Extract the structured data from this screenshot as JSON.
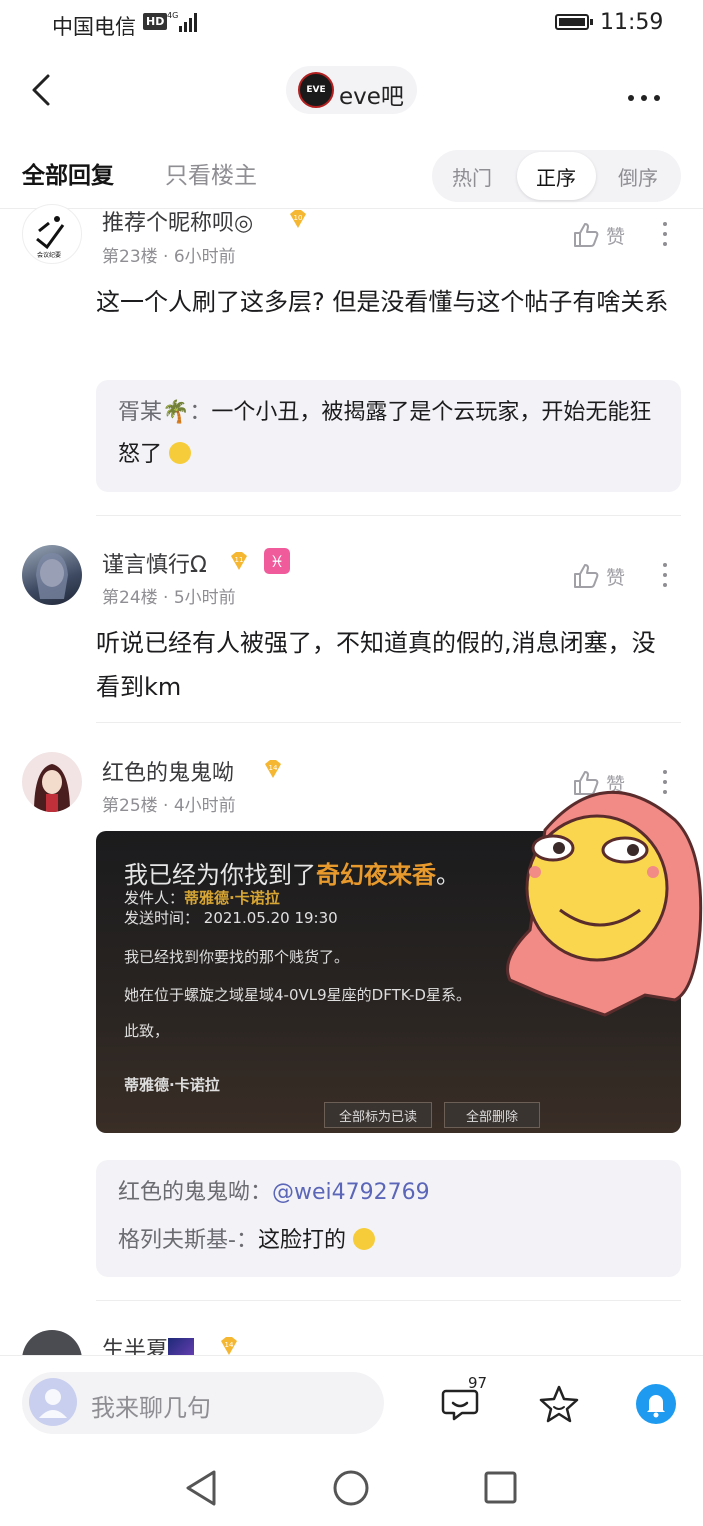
{
  "status": {
    "carrier": "中国电信",
    "hd": "HD",
    "network": "4G",
    "time": "11:59"
  },
  "nav": {
    "forum_name": "eve吧",
    "forum_logo_text": "EVE"
  },
  "tabs": {
    "all": "全部回复",
    "op_only": "只看楼主"
  },
  "sort": {
    "hot": "热门",
    "asc": "正序",
    "desc": "倒序",
    "selected": "正序"
  },
  "like_label": "赞",
  "posts": [
    {
      "username": "推荐个昵称呗◎",
      "level": "10",
      "floor": "第23楼",
      "time": "6小时前",
      "content": "这一个人刷了这多层? 但是没看懂与这个帖子有啥关系",
      "avatar_text": "会议纪要",
      "reply": {
        "name": "胥某🌴",
        "text": "一个小丑，被揭露了是个云玩家，开始无能狂怒了"
      }
    },
    {
      "username": "谨言慎行Ω",
      "level": "11",
      "extra_badge": "♓",
      "floor": "第24楼",
      "time": "5小时前",
      "content": "听说已经有人被强了，不知道真的假的,消息闭塞，没看到km"
    },
    {
      "username": "红色的鬼鬼呦",
      "level": "14",
      "floor": "第25楼",
      "time": "4小时前",
      "image": {
        "title_prefix": "我已经为你找到了",
        "title_highlight": "奇幻夜来香",
        "title_suffix": "。",
        "sender_label": "发件人：",
        "sender": "蒂雅德·卡诺拉",
        "sent_label": "发送时间：",
        "sent_time": "2021.05.20 19:30",
        "line1": "我已经找到你要找的那个贱货了。",
        "line2": "她在位于螺旋之域星域4-0VL9星座的DFTK-D星系。",
        "line3": "此致，",
        "signature": "蒂雅德·卡诺拉",
        "btn_read": "全部标为已读",
        "btn_delete": "全部删除"
      },
      "replies": [
        {
          "name": "红色的鬼鬼呦：",
          "mention": "@wei4792769"
        },
        {
          "name": "格列夫斯基-：",
          "text": "这脸打的"
        }
      ]
    },
    {
      "username": "生半夏",
      "level": "14"
    }
  ],
  "bottom": {
    "placeholder": "我来聊几句",
    "comment_count": "97"
  }
}
